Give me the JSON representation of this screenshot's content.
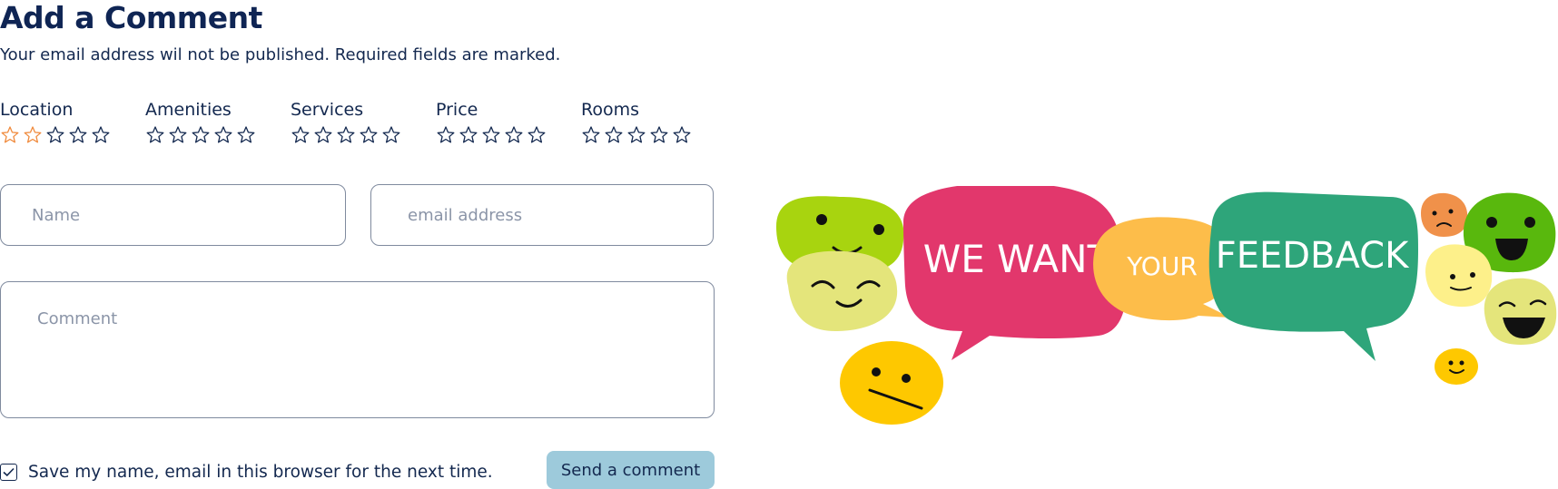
{
  "form": {
    "title": "Add a Comment",
    "subtitle": "Your email address wil not be published. Required fields are marked.",
    "ratings": [
      {
        "label": "Location",
        "rating": 2,
        "max": 5
      },
      {
        "label": "Amenities",
        "rating": 0,
        "max": 5
      },
      {
        "label": "Services",
        "rating": 0,
        "max": 5
      },
      {
        "label": "Price",
        "rating": 0,
        "max": 5
      },
      {
        "label": "Rooms",
        "rating": 0,
        "max": 5
      }
    ],
    "name_placeholder": "Name",
    "email_placeholder": "email address",
    "comment_placeholder": "Comment",
    "save_label": "Save my name, email in this browser for the next time.",
    "save_checked": true,
    "send_label": "Send a comment"
  },
  "illustration": {
    "text_1": "WE WANT",
    "text_2": "YOUR",
    "text_3": "FEEDBACK"
  },
  "colors": {
    "star_filled": "#f08a3c",
    "star_empty": "#13284f",
    "button_bg": "#9dcadb",
    "bubble_pink": "#e2376c",
    "bubble_orange": "#fdbd4a",
    "bubble_green": "#2ea57a"
  }
}
